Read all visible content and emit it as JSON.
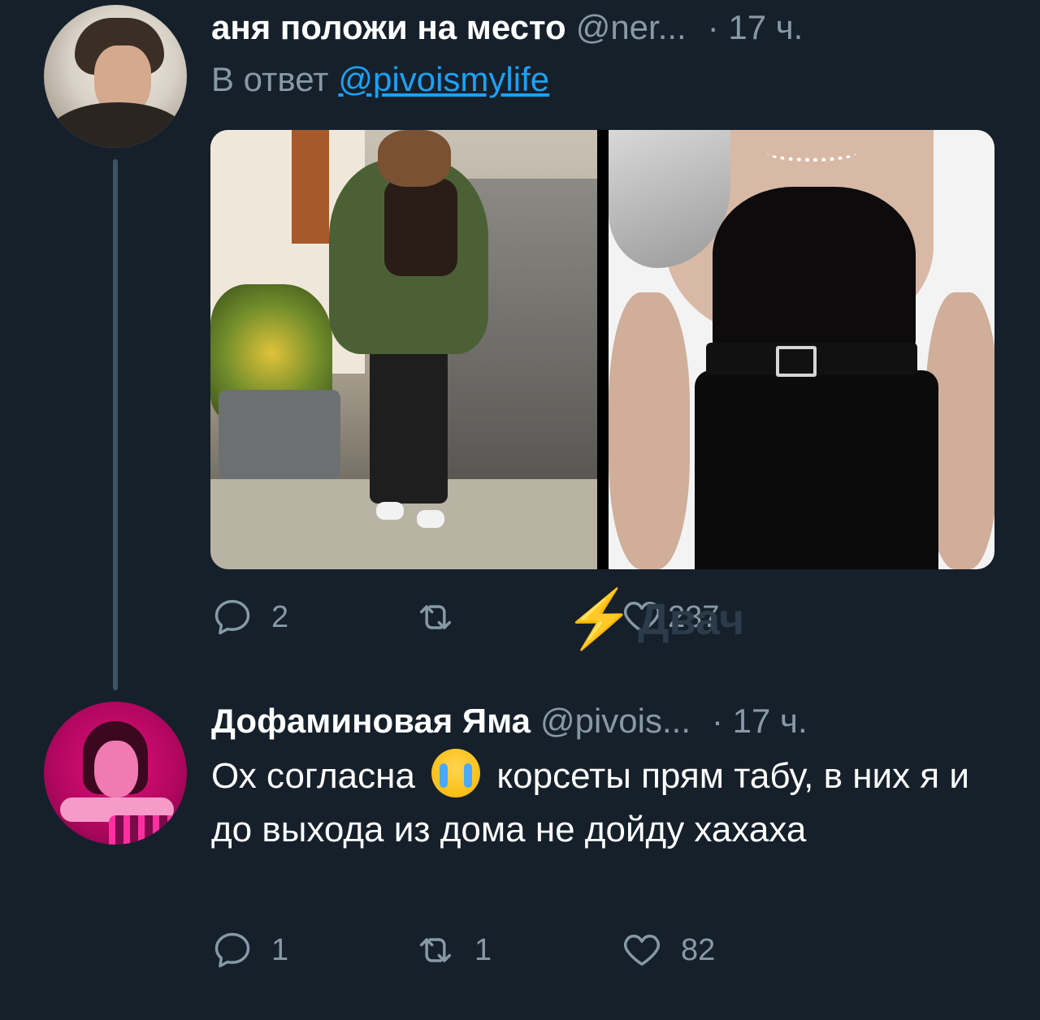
{
  "tweets": [
    {
      "name": "аня положи на место",
      "handle": "@ner...",
      "time": "· 17 ч.",
      "reply_prefix": "В ответ",
      "reply_mention": "@pivoismylife",
      "actions": {
        "reply_count": "2",
        "retweet_count": "",
        "like_count": "237"
      }
    },
    {
      "name": "Дофаминовая Яма",
      "handle": "@pivois...",
      "time": "· 17 ч.",
      "text_before_emoji": "Ох согласна",
      "emoji": "loudly-crying-face",
      "text_after_emoji": "корсеты прям табу, в них я и до выхода из дома не дойду хахаха",
      "actions": {
        "reply_count": "1",
        "retweet_count": "1",
        "like_count": "82"
      }
    }
  ],
  "watermark": {
    "text": "Двач"
  },
  "colors": {
    "background": "#15202b",
    "secondary_text": "#8899a6",
    "link": "#1da1f2",
    "thread_line": "#3d5466"
  }
}
